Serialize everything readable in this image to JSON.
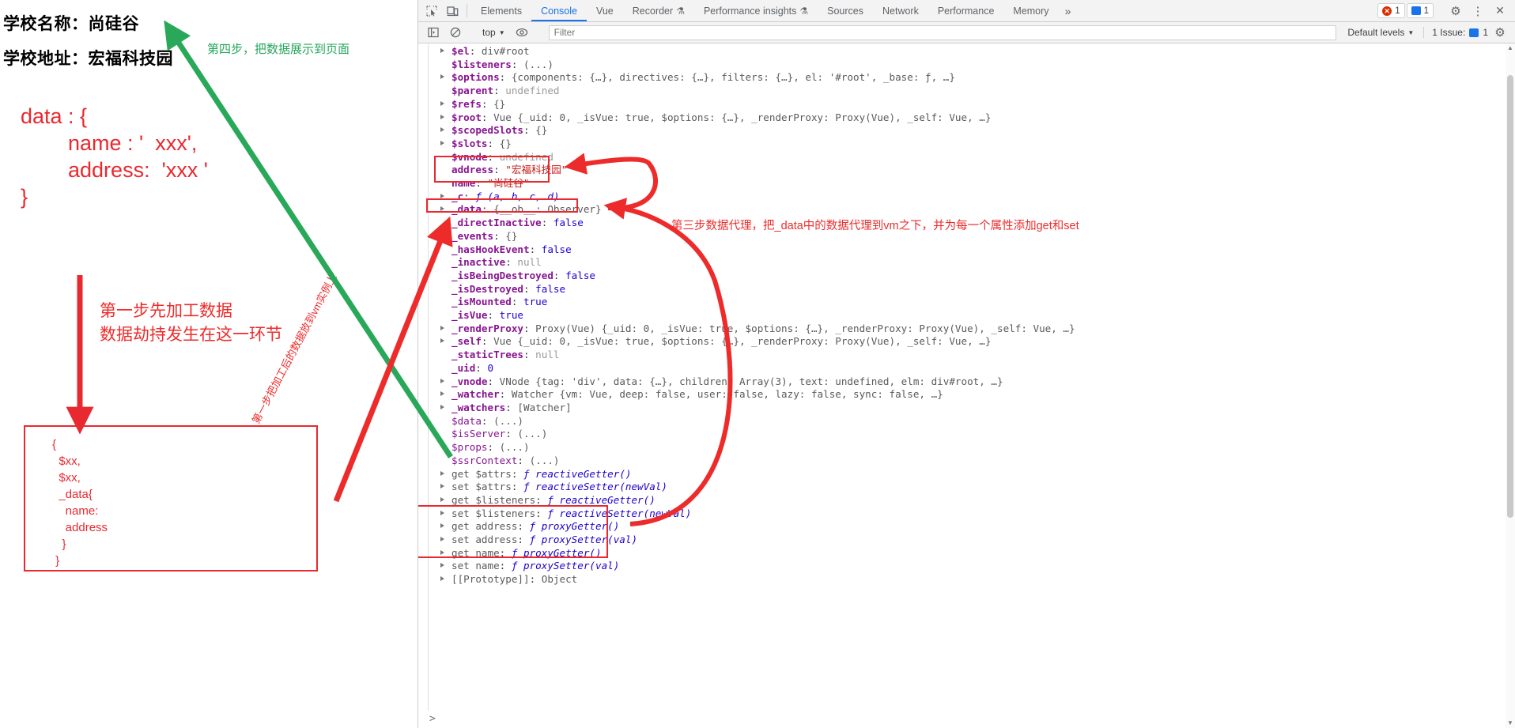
{
  "slide": {
    "school_name_line": "学校名称：尚硅谷",
    "school_address_line": "学校地址：宏福科技园",
    "data_snippet": "data : {\n        name : '  xxx',\n        address:  'xxx '\n}",
    "note_step4": "第四步，把数据展示到页面",
    "note_step1": "第一步先加工数据\n数据劫持发生在这一环节",
    "note_rotated": "第一步把加工后的数据放到vm实例上",
    "red_box_code": "{\n  $xx,\n  $xx,\n  _data{\n    name:\n    address\n   }\n }"
  },
  "annotations": {
    "step3": "第三步数据代理，把_data中的数据代理到vm之下，并为每一个属性添加get和set"
  },
  "devtools": {
    "tabs": [
      {
        "label": "Elements",
        "active": false,
        "beaker": false
      },
      {
        "label": "Console",
        "active": true,
        "beaker": false
      },
      {
        "label": "Vue",
        "active": false,
        "beaker": false
      },
      {
        "label": "Recorder",
        "active": false,
        "beaker": true
      },
      {
        "label": "Performance insights",
        "active": false,
        "beaker": true
      },
      {
        "label": "Sources",
        "active": false,
        "beaker": false
      },
      {
        "label": "Network",
        "active": false,
        "beaker": false
      },
      {
        "label": "Performance",
        "active": false,
        "beaker": false
      },
      {
        "label": "Memory",
        "active": false,
        "beaker": false
      }
    ],
    "more_tabs_label": "»",
    "error_count": "1",
    "info_count": "1",
    "settings_label": "⚙",
    "kebab_label": "⋮",
    "close_label": "✕",
    "filter": {
      "context_label": "top",
      "placeholder": "Filter",
      "value": "",
      "levels_label": "Default levels",
      "issues_label": "1 Issue:",
      "issues_count": "1"
    },
    "prompt_symbol": ">"
  },
  "console_lines": [
    {
      "tri": true,
      "key": "$el",
      "sep": ": ",
      "value": "div#root",
      "vclass": "v-obj"
    },
    {
      "tri": false,
      "key": "$listeners",
      "sep": ": ",
      "value": "(...)",
      "vclass": "v-obj"
    },
    {
      "tri": true,
      "key": "$options",
      "sep": ": ",
      "value": "{components: {…}, directives: {…}, filters: {…}, el: '#root', _base: ƒ, …}",
      "vclass": "v-obj"
    },
    {
      "tri": false,
      "key": "$parent",
      "sep": ": ",
      "value": "undefined",
      "vclass": "v-undef"
    },
    {
      "tri": true,
      "key": "$refs",
      "sep": ": ",
      "value": "{}",
      "vclass": "v-obj"
    },
    {
      "tri": true,
      "key": "$root",
      "sep": ": ",
      "value": "Vue {_uid: 0, _isVue: true, $options: {…}, _renderProxy: Proxy(Vue), _self: Vue, …}",
      "vclass": "v-obj"
    },
    {
      "tri": true,
      "key": "$scopedSlots",
      "sep": ": ",
      "value": "{}",
      "vclass": "v-obj"
    },
    {
      "tri": true,
      "key": "$slots",
      "sep": ": ",
      "value": "{}",
      "vclass": "v-obj"
    },
    {
      "tri": false,
      "key": "$vnode",
      "sep": ": ",
      "value": "undefined",
      "vclass": "v-undef"
    },
    {
      "tri": false,
      "key": "address",
      "sep": ": ",
      "value": "\"宏福科技园\"",
      "vclass": "v-str"
    },
    {
      "tri": false,
      "key": "name",
      "sep": ": ",
      "value": "\"尚硅谷\"",
      "vclass": "v-str"
    },
    {
      "tri": true,
      "key": "_c",
      "sep": ": ",
      "value": "ƒ (a, b, c, d)",
      "vclass": "v-fn"
    },
    {
      "tri": true,
      "key": "_data",
      "sep": ": ",
      "value": "{__ob__: Observer}",
      "vclass": "v-obj"
    },
    {
      "tri": false,
      "key": "_directInactive",
      "sep": ": ",
      "value": "false",
      "vclass": "v-bool"
    },
    {
      "tri": true,
      "key": "_events",
      "sep": ": ",
      "value": "{}",
      "vclass": "v-obj"
    },
    {
      "tri": false,
      "key": "_hasHookEvent",
      "sep": ": ",
      "value": "false",
      "vclass": "v-bool"
    },
    {
      "tri": false,
      "key": "_inactive",
      "sep": ": ",
      "value": "null",
      "vclass": "v-undef"
    },
    {
      "tri": false,
      "key": "_isBeingDestroyed",
      "sep": ": ",
      "value": "false",
      "vclass": "v-bool"
    },
    {
      "tri": false,
      "key": "_isDestroyed",
      "sep": ": ",
      "value": "false",
      "vclass": "v-bool"
    },
    {
      "tri": false,
      "key": "_isMounted",
      "sep": ": ",
      "value": "true",
      "vclass": "v-bool"
    },
    {
      "tri": false,
      "key": "_isVue",
      "sep": ": ",
      "value": "true",
      "vclass": "v-bool"
    },
    {
      "tri": true,
      "key": "_renderProxy",
      "sep": ": ",
      "value": "Proxy(Vue) {_uid: 0, _isVue: true, $options: {…}, _renderProxy: Proxy(Vue), _self: Vue, …}",
      "vclass": "v-obj"
    },
    {
      "tri": true,
      "key": "_self",
      "sep": ": ",
      "value": "Vue {_uid: 0, _isVue: true, $options: {…}, _renderProxy: Proxy(Vue), _self: Vue, …}",
      "vclass": "v-obj"
    },
    {
      "tri": false,
      "key": "_staticTrees",
      "sep": ": ",
      "value": "null",
      "vclass": "v-undef"
    },
    {
      "tri": false,
      "key": "_uid",
      "sep": ": ",
      "value": "0",
      "vclass": "v-num"
    },
    {
      "tri": true,
      "key": "_vnode",
      "sep": ": ",
      "value": "VNode {tag: 'div', data: {…}, children: Array(3), text: undefined, elm: div#root, …}",
      "vclass": "v-obj"
    },
    {
      "tri": true,
      "key": "_watcher",
      "sep": ": ",
      "value": "Watcher {vm: Vue, deep: false, user: false, lazy: false, sync: false, …}",
      "vclass": "v-obj"
    },
    {
      "tri": true,
      "key": "_watchers",
      "sep": ": ",
      "value": "[Watcher]",
      "vclass": "v-obj"
    },
    {
      "tri": false,
      "key": "$data",
      "sep": ": ",
      "value": "(...)",
      "vclass": "v-obj",
      "kclass": "k-plain"
    },
    {
      "tri": false,
      "key": "$isServer",
      "sep": ": ",
      "value": "(...)",
      "vclass": "v-obj",
      "kclass": "k-plain"
    },
    {
      "tri": false,
      "key": "$props",
      "sep": ": ",
      "value": "(...)",
      "vclass": "v-obj",
      "kclass": "k-plain"
    },
    {
      "tri": false,
      "key": "$ssrContext",
      "sep": ": ",
      "value": "(...)",
      "vclass": "v-obj",
      "kclass": "k-plain"
    },
    {
      "tri": true,
      "key": "get $attrs",
      "sep": ": ",
      "value": "ƒ reactiveGetter()",
      "vclass": "v-fn",
      "kclass": "k-getter"
    },
    {
      "tri": true,
      "key": "set $attrs",
      "sep": ": ",
      "value": "ƒ reactiveSetter(newVal)",
      "vclass": "v-fn",
      "kclass": "k-getter"
    },
    {
      "tri": true,
      "key": "get $listeners",
      "sep": ": ",
      "value": "ƒ reactiveGetter()",
      "vclass": "v-fn",
      "kclass": "k-getter"
    },
    {
      "tri": true,
      "key": "set $listeners",
      "sep": ": ",
      "value": "ƒ reactiveSetter(newVal)",
      "vclass": "v-fn",
      "kclass": "k-getter"
    },
    {
      "tri": true,
      "key": "get address",
      "sep": ": ",
      "value": "ƒ proxyGetter()",
      "vclass": "v-fn",
      "kclass": "k-getter"
    },
    {
      "tri": true,
      "key": "set address",
      "sep": ": ",
      "value": "ƒ proxySetter(val)",
      "vclass": "v-fn",
      "kclass": "k-getter"
    },
    {
      "tri": true,
      "key": "get name",
      "sep": ": ",
      "value": "ƒ proxyGetter()",
      "vclass": "v-fn",
      "kclass": "k-getter"
    },
    {
      "tri": true,
      "key": "set name",
      "sep": ": ",
      "value": "ƒ proxySetter(val)",
      "vclass": "v-fn",
      "kclass": "k-getter"
    },
    {
      "tri": true,
      "key": "[[Prototype]]",
      "sep": ": ",
      "value": "Object",
      "vclass": "v-obj",
      "kclass": "k-getter"
    }
  ],
  "colors": {
    "accent": "#1a73e8",
    "annotation_red": "#e8292f",
    "annotation_green": "#26a65b",
    "key_purple": "#881391",
    "string_red": "#c41a16",
    "number_blue": "#1c00cf"
  }
}
